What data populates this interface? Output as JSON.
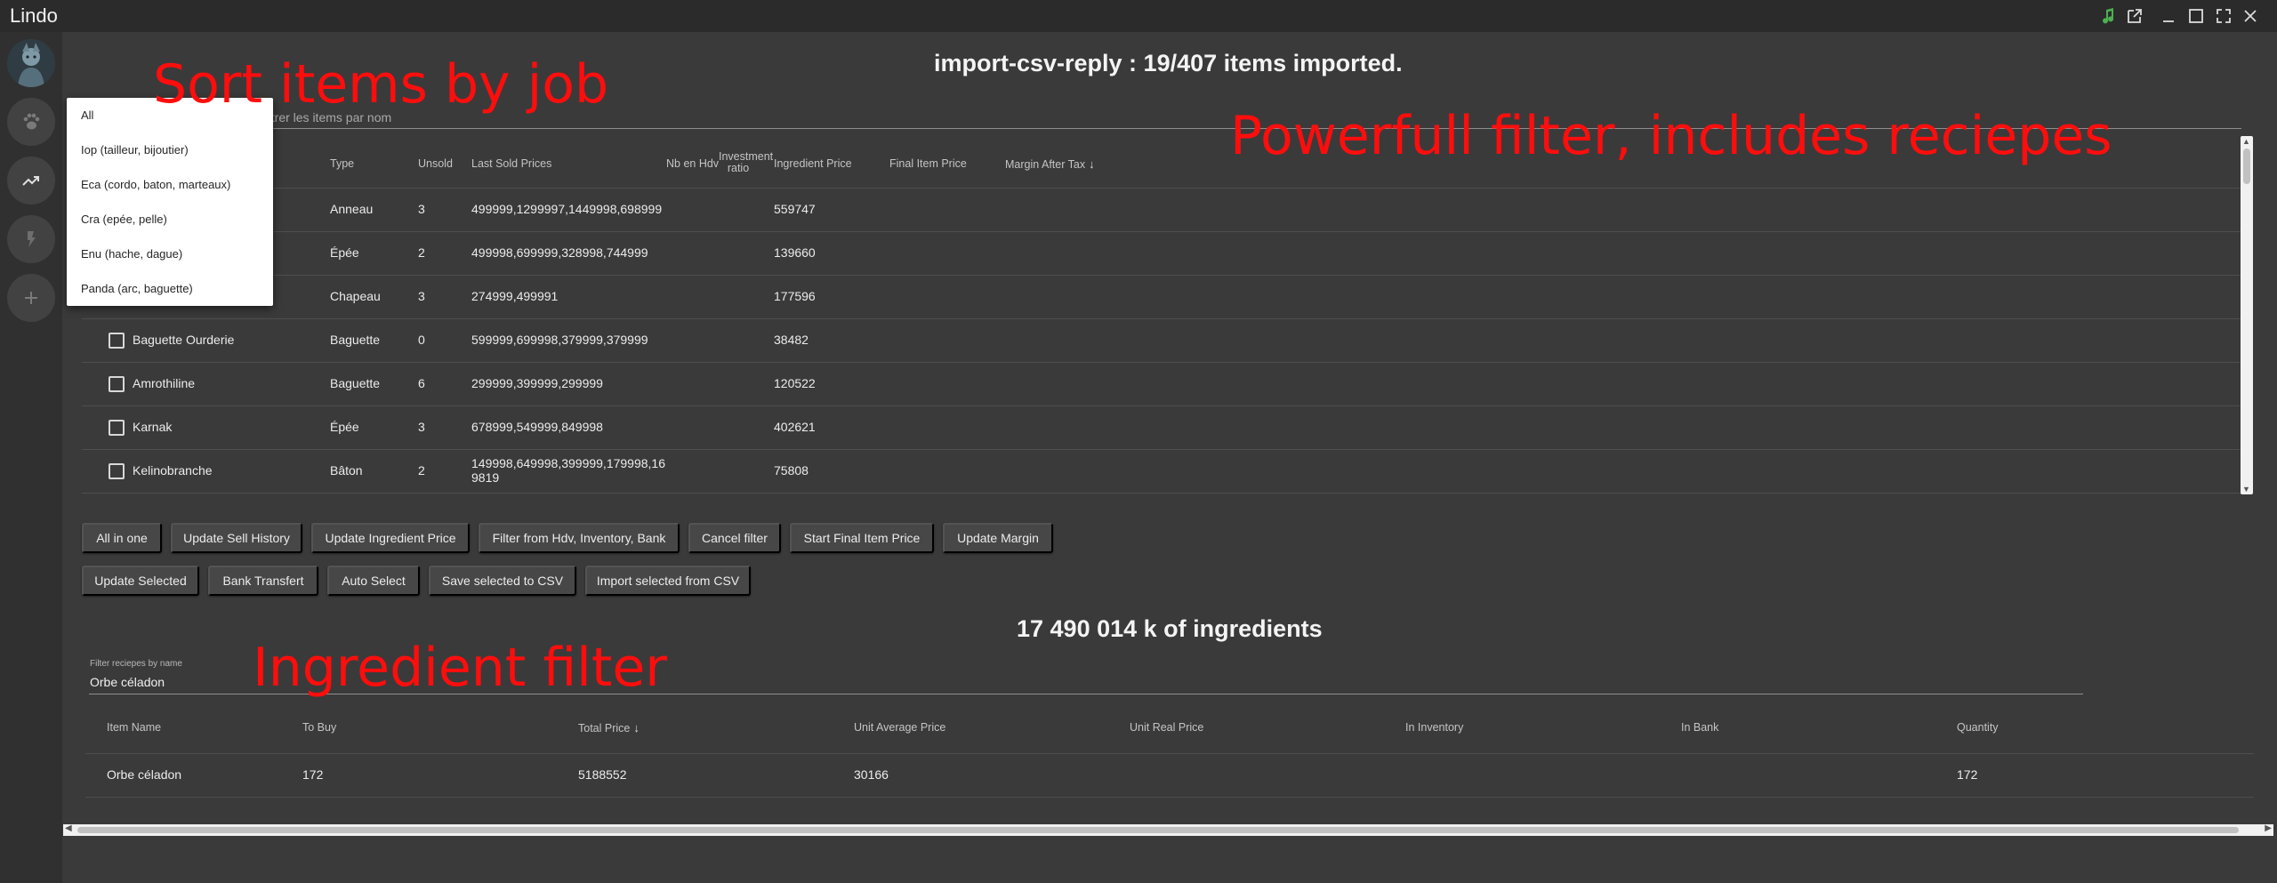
{
  "app": {
    "title": "Lindo"
  },
  "window_controls": [
    "music-icon",
    "external-link-icon",
    "minimize-icon",
    "maximize-icon",
    "fullscreen-icon",
    "close-icon"
  ],
  "header": {
    "title": "import-csv-reply : 19/407 items imported."
  },
  "item_search": {
    "placeholder": "Filtrer les items par nom"
  },
  "job_filter": {
    "options": [
      "All",
      "Iop (tailleur, bijoutier)",
      "Eca (cordo, baton, marteaux)",
      "Cra (epée, pelle)",
      "Enu (hache, dague)",
      "Panda (arc, baguette)"
    ]
  },
  "items_table": {
    "headers": {
      "type": "Type",
      "unsold": "Unsold",
      "last_sold": "Last Sold Prices",
      "nb_hdv": "Nb en Hdv",
      "investment_ratio_1": "Investment",
      "investment_ratio_2": "ratio",
      "ingredient_price": "Ingredient Price",
      "final_item_price": "Final Item Price",
      "margin_after_tax": "Margin After Tax"
    },
    "rows": [
      {
        "name": "",
        "type": "Anneau",
        "unsold": "3",
        "last_sold": "499999,1299997,1449998,698999",
        "ingredient_price": "559747"
      },
      {
        "name": "",
        "type": "Épée",
        "unsold": "2",
        "last_sold": "499998,699999,328998,744999",
        "ingredient_price": "139660"
      },
      {
        "name": "",
        "type": "Chapeau",
        "unsold": "3",
        "last_sold": "274999,499991",
        "ingredient_price": "177596"
      },
      {
        "name": "Baguette Ourderie",
        "type": "Baguette",
        "unsold": "0",
        "last_sold": "599999,699998,379999,379999",
        "ingredient_price": "38482"
      },
      {
        "name": "Amrothiline",
        "type": "Baguette",
        "unsold": "6",
        "last_sold": "299999,399999,299999",
        "ingredient_price": "120522"
      },
      {
        "name": "Karnak",
        "type": "Épée",
        "unsold": "3",
        "last_sold": "678999,549999,849998",
        "ingredient_price": "402621"
      },
      {
        "name": "Kelinobranche",
        "type": "Bâton",
        "unsold": "2",
        "last_sold": "149998,649998,399999,179998,169819",
        "ingredient_price": "75808"
      }
    ]
  },
  "actions_row1": [
    "All in one",
    "Update Sell History",
    "Update Ingredient Price",
    "Filter from Hdv, Inventory, Bank",
    "Cancel filter",
    "Start Final Item Price",
    "Update Margin"
  ],
  "actions_row2": [
    "Update Selected",
    "Bank Transfert",
    "Auto Select",
    "Save selected to CSV",
    "Import selected from CSV"
  ],
  "ingredients": {
    "summary": "17 490 014 k of ingredients",
    "filter_label": "Filter reciepes by name",
    "filter_value": "Orbe céladon",
    "headers": {
      "item_name": "Item Name",
      "to_buy": "To Buy",
      "total_price": "Total Price",
      "unit_avg": "Unit Average Price",
      "unit_real": "Unit Real Price",
      "in_inventory": "In Inventory",
      "in_bank": "In Bank",
      "quantity": "Quantity"
    },
    "rows": [
      {
        "item_name": "Orbe céladon",
        "to_buy": "172",
        "total_price": "5188552",
        "unit_avg": "30166",
        "unit_real": "",
        "in_inventory": "",
        "in_bank": "",
        "quantity": "172"
      }
    ]
  },
  "annotations": {
    "sort_by_job": "Sort items by job",
    "powerful_filter": "Powerfull filter, includes reciepes",
    "ingredient_filter": "Ingredient filter"
  },
  "colors": {
    "annotation": "#ff0d0d",
    "background": "#3a3a3a",
    "titlebar": "#2b2b2b",
    "music_icon": "#4caf50"
  }
}
